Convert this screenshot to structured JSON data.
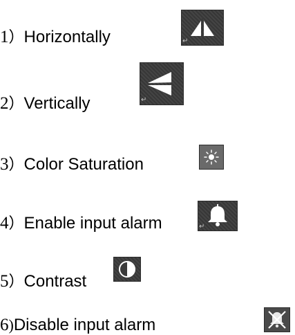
{
  "items": [
    {
      "num": "1",
      "paren": "）",
      "label": "Horizontally",
      "icon": "flip-horizontal-icon"
    },
    {
      "num": "2",
      "paren": "）",
      "label": "Vertically",
      "icon": "flip-vertical-icon"
    },
    {
      "num": "3",
      "paren": "）",
      "label": "Color Saturation",
      "icon": "saturation-sun-icon"
    },
    {
      "num": "4",
      "paren": "）",
      "label": "Enable input alarm",
      "icon": "alarm-bell-icon"
    },
    {
      "num": "5",
      "paren": "）",
      "label": "Contrast",
      "icon": "contrast-icon"
    },
    {
      "num": "6",
      "paren": ")",
      "label": "Disable input alarm",
      "icon": "alarm-disabled-icon"
    }
  ],
  "colors": {
    "icon_bg": "#3a3a3a",
    "icon_fg": "#ffffff",
    "text": "#000000"
  }
}
